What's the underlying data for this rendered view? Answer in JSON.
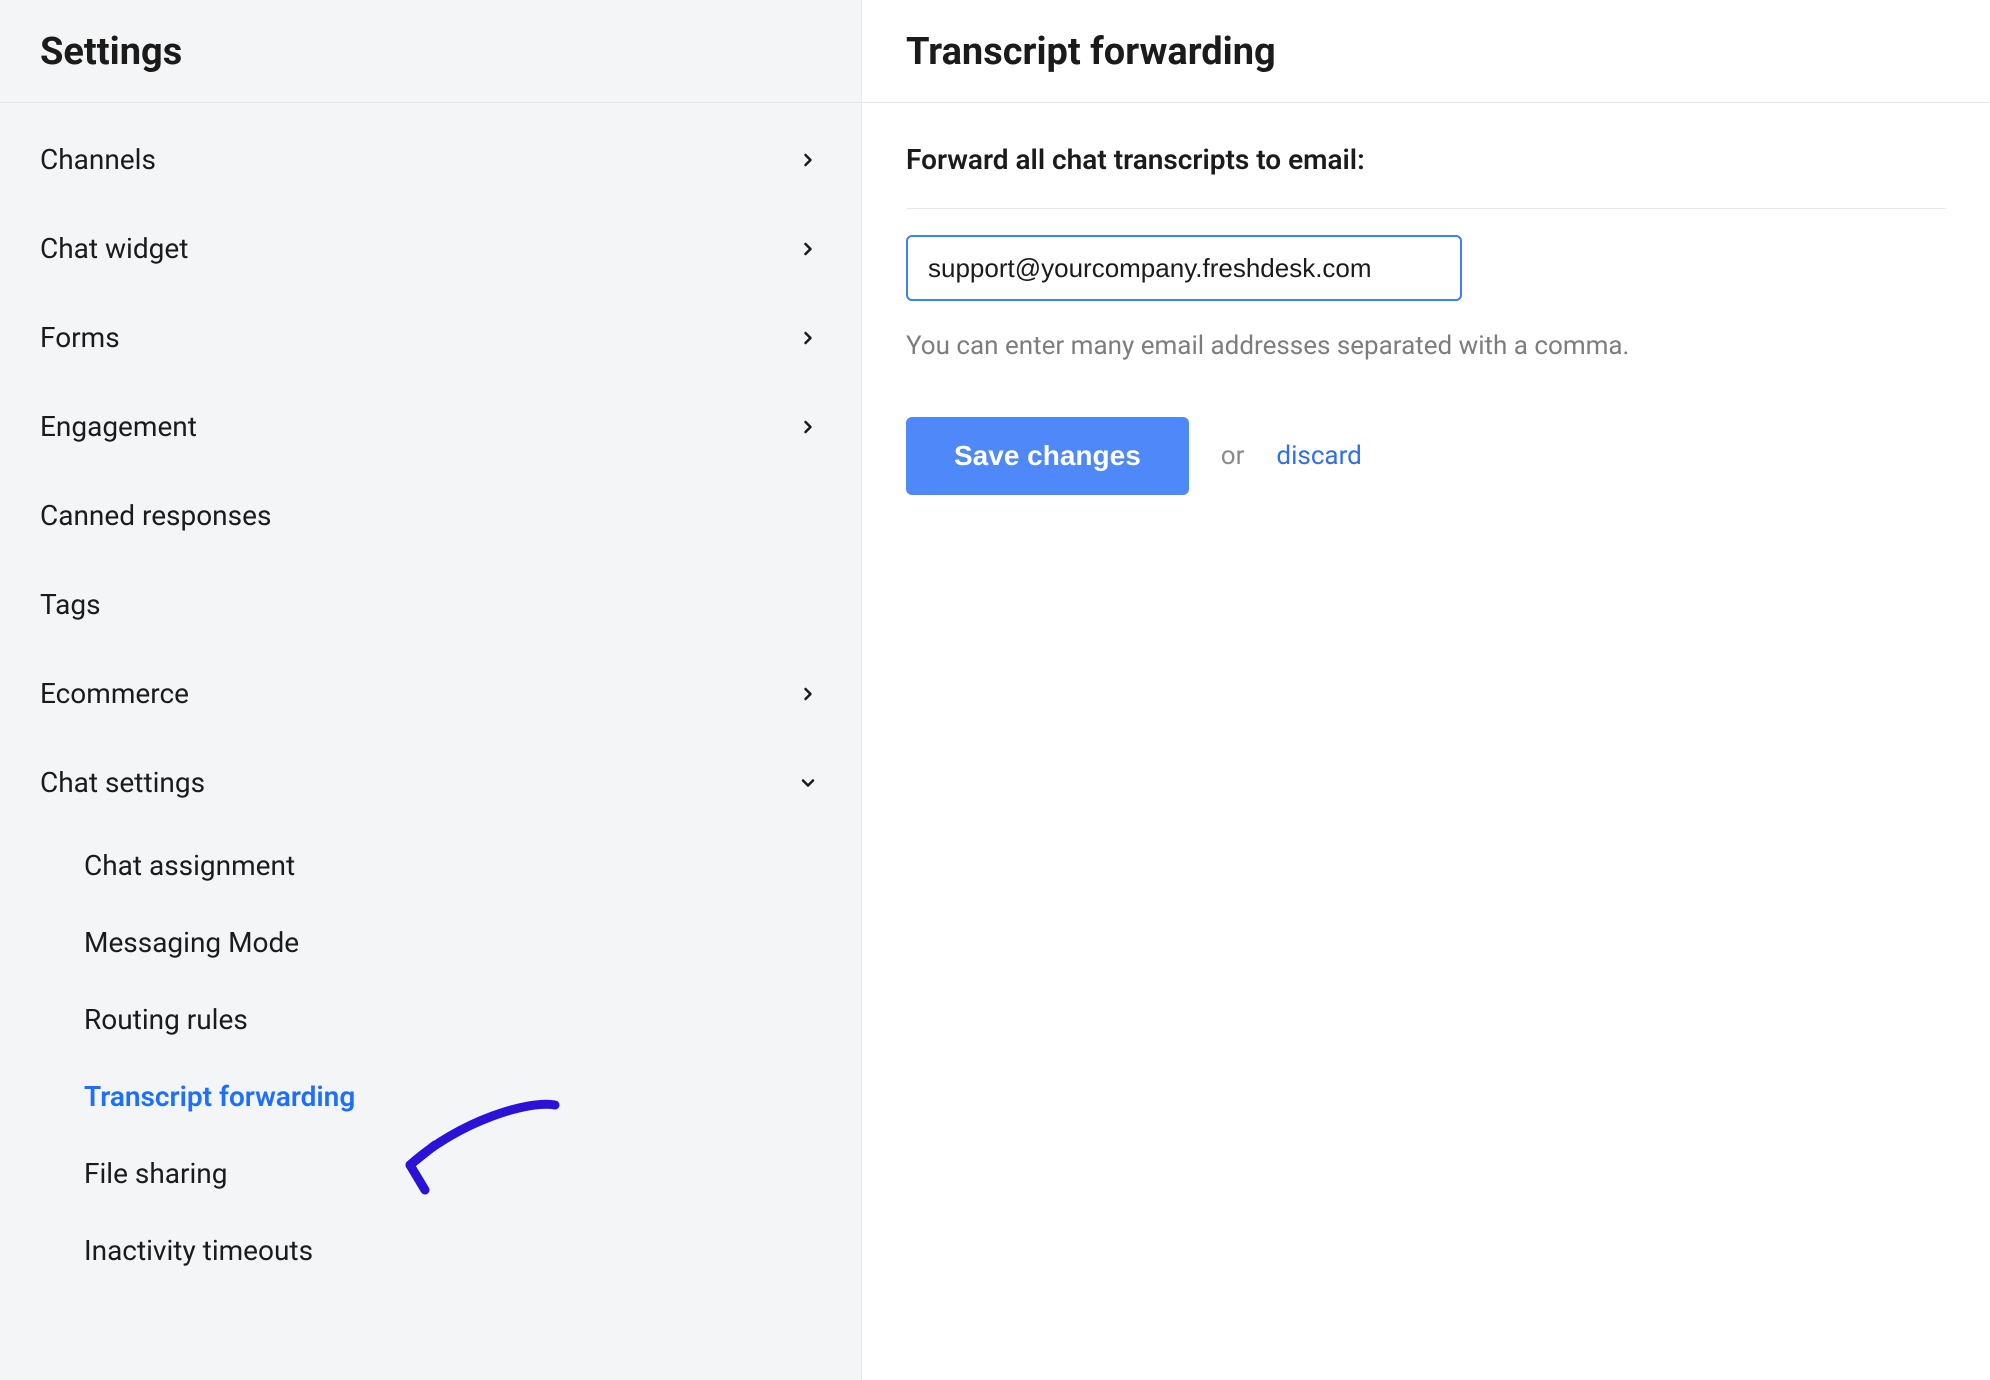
{
  "sidebar": {
    "title": "Settings",
    "items": [
      {
        "label": "Channels",
        "expandable": true,
        "expanded": false
      },
      {
        "label": "Chat widget",
        "expandable": true,
        "expanded": false
      },
      {
        "label": "Forms",
        "expandable": true,
        "expanded": false
      },
      {
        "label": "Engagement",
        "expandable": true,
        "expanded": false
      },
      {
        "label": "Canned responses",
        "expandable": false,
        "expanded": false
      },
      {
        "label": "Tags",
        "expandable": false,
        "expanded": false
      },
      {
        "label": "Ecommerce",
        "expandable": true,
        "expanded": false
      },
      {
        "label": "Chat settings",
        "expandable": true,
        "expanded": true
      }
    ],
    "chat_settings_subitems": [
      {
        "label": "Chat assignment",
        "active": false
      },
      {
        "label": "Messaging Mode",
        "active": false
      },
      {
        "label": "Routing rules",
        "active": false
      },
      {
        "label": "Transcript forwarding",
        "active": true
      },
      {
        "label": "File sharing",
        "active": false
      },
      {
        "label": "Inactivity timeouts",
        "active": false
      }
    ]
  },
  "main": {
    "title": "Transcript forwarding",
    "field_label": "Forward all chat transcripts to email:",
    "email_value": "support@yourcompany.freshdesk.com",
    "hint": "You can enter many email addresses separated with a comma.",
    "save_label": "Save changes",
    "or_label": "or",
    "discard_label": "discard"
  },
  "colors": {
    "sidebar_bg": "#f3f5f7",
    "border": "#e6e8eb",
    "accent": "#1f6fff",
    "button": "#4e88f9",
    "text": "#1b1b1b",
    "muted": "#7d7d7d",
    "annotation": "#2a12d8"
  }
}
